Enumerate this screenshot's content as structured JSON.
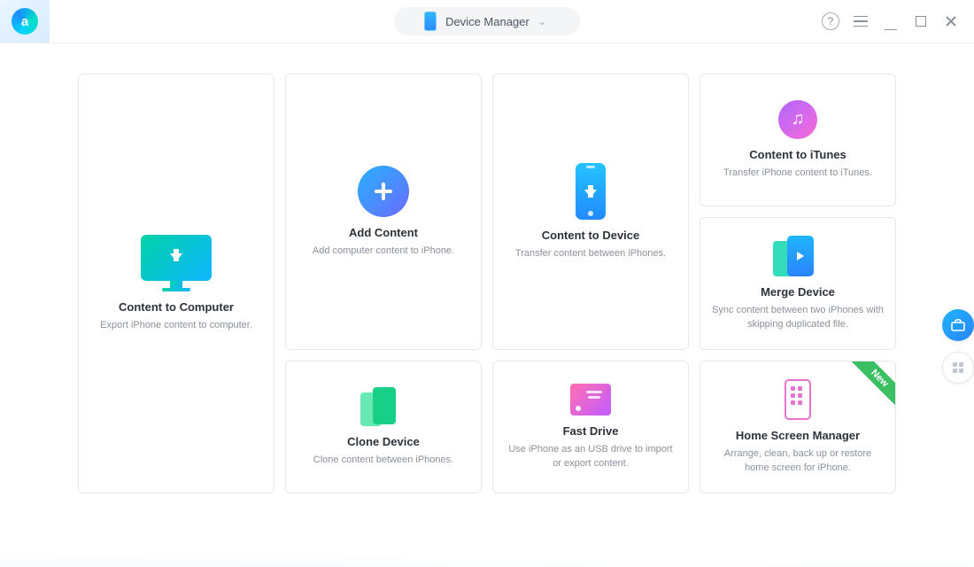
{
  "header": {
    "device_label": "Device Manager"
  },
  "cards": {
    "c1": {
      "title": "Content to Computer",
      "subtitle": "Export iPhone content to computer."
    },
    "c2": {
      "title": "Add Content",
      "subtitle": "Add computer content to iPhone."
    },
    "c3": {
      "title": "Content to Device",
      "subtitle": "Transfer content between iPhones."
    },
    "c4": {
      "title": "Content to iTunes",
      "subtitle": "Transfer iPhone content to iTunes."
    },
    "c5": {
      "title": "Merge Device",
      "subtitle": "Sync content between two iPhones with skipping duplicated file."
    },
    "c6": {
      "title": "Clone Device",
      "subtitle": "Clone content between iPhones."
    },
    "c7": {
      "title": "Fast Drive",
      "subtitle": "Use iPhone as an USB drive to import or export content."
    },
    "c8": {
      "title": "Home Screen Manager",
      "subtitle": "Arrange, clean, back up or restore home screen for iPhone.",
      "badge": "New"
    }
  },
  "colors": {
    "accent_blue": "#228aff",
    "accent_teal": "#0fd7b0",
    "ribbon_green": "#3bbf63"
  }
}
